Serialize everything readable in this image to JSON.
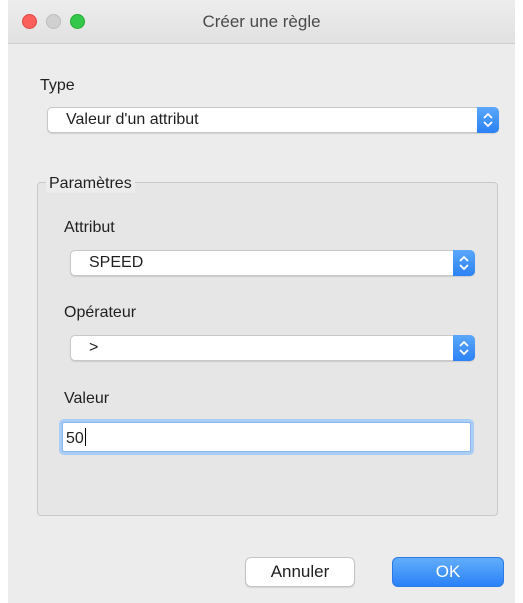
{
  "window": {
    "title": "Créer une règle"
  },
  "type_section": {
    "label": "Type",
    "selected": "Valeur d'un attribut"
  },
  "params": {
    "legend": "Paramètres",
    "attribute_label": "Attribut",
    "attribute_value": "SPEED",
    "operator_label": "Opérateur",
    "operator_value": ">",
    "value_label": "Valeur",
    "value_text": "50"
  },
  "buttons": {
    "cancel": "Annuler",
    "ok": "OK"
  },
  "colors": {
    "accent": "#2c82f5",
    "close": "#fc605c",
    "maximize": "#34c84a"
  }
}
